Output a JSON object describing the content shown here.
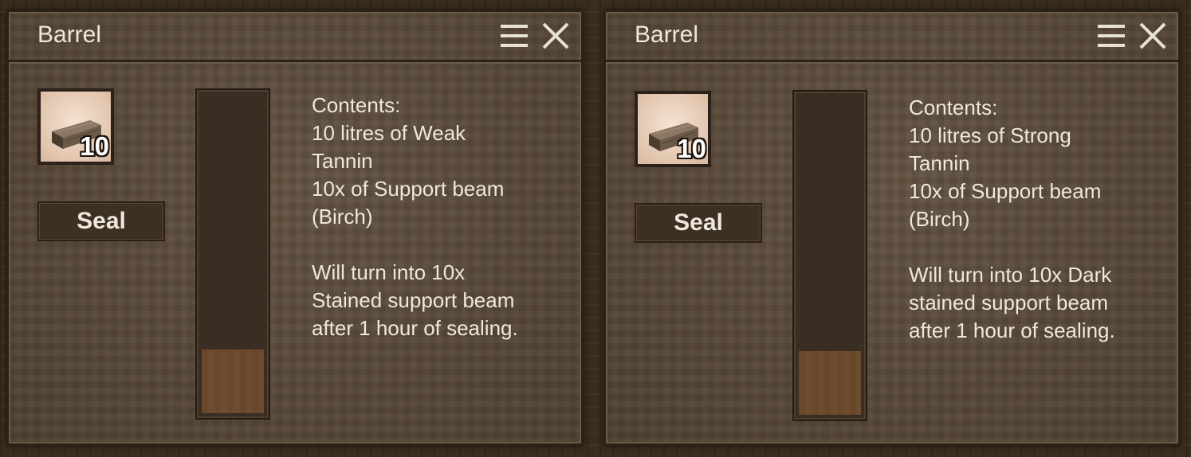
{
  "dialogs": [
    {
      "title": "Barrel",
      "item": {
        "icon": "support-beam-birch-icon",
        "count": "10"
      },
      "seal_label": "Seal",
      "fill_level": 0.2,
      "contents_lines": [
        "Contents:",
        "10 litres of Weak",
        "Tannin",
        "10x of Support beam",
        "(Birch)"
      ],
      "result_lines": [
        "Will turn into 10x",
        "Stained support beam",
        "after 1 hour of sealing."
      ]
    },
    {
      "title": "Barrel",
      "item": {
        "icon": "support-beam-birch-icon",
        "count": "10"
      },
      "seal_label": "Seal",
      "fill_level": 0.2,
      "contents_lines": [
        "Contents:",
        "10 litres of Strong",
        "Tannin",
        "10x of Support beam",
        "(Birch)"
      ],
      "result_lines": [
        "Will turn into 10x Dark",
        "stained support beam",
        "after 1 hour of sealing."
      ]
    }
  ],
  "colors": {
    "text": "#eee8dc",
    "panel": "#5a4a38",
    "liquid": "#6f4c30"
  }
}
